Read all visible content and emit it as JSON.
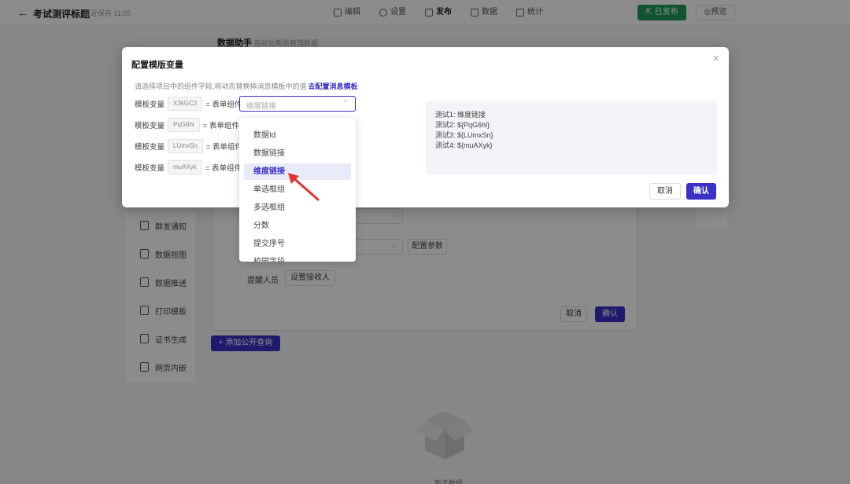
{
  "topbar": {
    "title": "考试测评标题",
    "saved": "最近保存 11:25",
    "tabs": [
      {
        "label": "编辑",
        "icon": "edit-icon"
      },
      {
        "label": "设置",
        "icon": "gear-icon"
      },
      {
        "label": "发布",
        "icon": "publish-icon"
      },
      {
        "label": "数据",
        "icon": "data-icon"
      },
      {
        "label": "统计",
        "icon": "chart-icon"
      }
    ],
    "published_label": "已发布",
    "preview_label": "预览"
  },
  "helper": {
    "title": "数据助手",
    "subtitle": "自动化帮助管理数据"
  },
  "sidebar": {
    "items": [
      {
        "label": "群发通知"
      },
      {
        "label": "数据视图"
      },
      {
        "label": "数据推送"
      },
      {
        "label": "打印模板"
      },
      {
        "label": "证书生成"
      },
      {
        "label": "网页内嵌"
      }
    ]
  },
  "bg_panel": {
    "config_params": "配置参数",
    "remind_label": "提醒人员",
    "set_recipient": "设置接收人",
    "cancel": "取消",
    "ok": "确认",
    "add_public_query": "+ 添加公开查询",
    "empty_text": "暂无数据"
  },
  "modal": {
    "title": "配置模版变量",
    "hint": "请选择项目中的组件字段,将动态替换掉消息模板中的值",
    "hint_link": "去配置消息模板",
    "rows": [
      {
        "label": "模板变量",
        "code": "X3kGC2",
        "eq": "= 表单组件"
      },
      {
        "label": "模板变量",
        "code": "PqG6hl",
        "eq": "= 表单组件"
      },
      {
        "label": "模板变量",
        "code": "LUmxSn",
        "eq": "= 表单组件"
      },
      {
        "label": "模板变量",
        "code": "muAXyk",
        "eq": "= 表单组件"
      }
    ],
    "select_value": "维度链接",
    "preview_lines": [
      "测试1: 维度链接",
      "测试2: ${PqG6hl}",
      "测试3: ${LUmxSn}",
      "测试4: ${muAXyk}"
    ],
    "cancel": "取消",
    "ok": "确认"
  },
  "dropdown": {
    "options": [
      "数据Id",
      "数据链接",
      "维度链接",
      "单选框组",
      "多选框组",
      "分数",
      "提交序号",
      "校园字段"
    ],
    "selected": "维度链接"
  },
  "colors": {
    "accent": "#3b31c6",
    "published": "#1f9a5b",
    "arrow": "#e0352b"
  }
}
